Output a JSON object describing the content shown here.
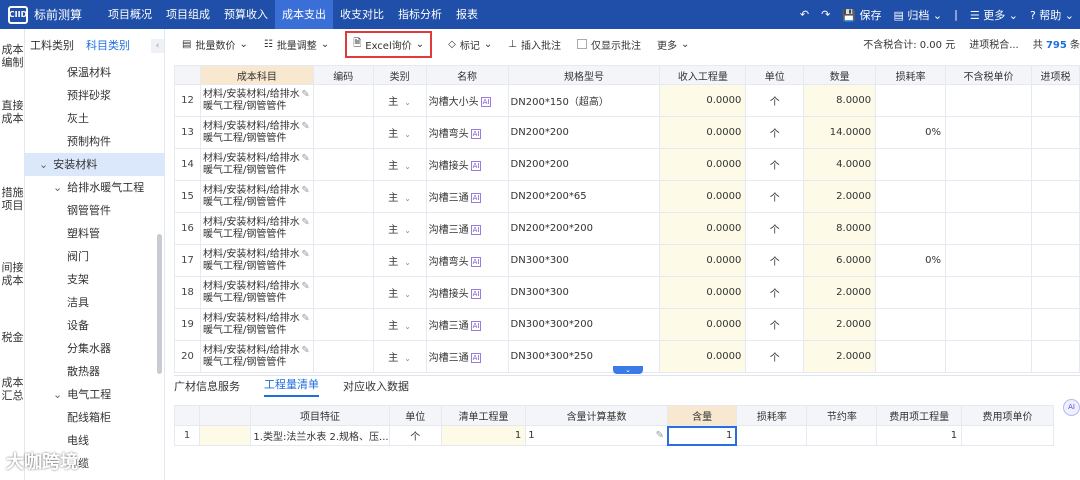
{
  "app": {
    "logo_mark": "CIID",
    "title": "标前测算"
  },
  "nav": [
    "项目概况",
    "项目组成",
    "预算收入",
    "成本支出",
    "收支对比",
    "指标分析",
    "报表"
  ],
  "nav_active": 3,
  "topright": {
    "save": "保存",
    "archive": "归档",
    "more": "更多",
    "help": "帮助"
  },
  "sidebar": [
    "成本编制",
    "直接成本",
    "措施项目",
    "间接成本",
    "税金",
    "成本汇总"
  ],
  "tree": {
    "tabs": [
      "工料类别",
      "科目类别"
    ],
    "items": [
      {
        "label": "保温材料",
        "indent": 3
      },
      {
        "label": "预拌砂浆",
        "indent": 3
      },
      {
        "label": "灰土",
        "indent": 3
      },
      {
        "label": "预制构件",
        "indent": 3
      },
      {
        "label": "安装材料",
        "indent": 1,
        "selected": true,
        "toggle": "⌄"
      },
      {
        "label": "给排水暖气工程",
        "indent": 2,
        "toggle": "⌄"
      },
      {
        "label": "钢管管件",
        "indent": 3
      },
      {
        "label": "塑料管",
        "indent": 3
      },
      {
        "label": "阀门",
        "indent": 3
      },
      {
        "label": "支架",
        "indent": 3
      },
      {
        "label": "洁具",
        "indent": 3
      },
      {
        "label": "设备",
        "indent": 3
      },
      {
        "label": "分集水器",
        "indent": 3
      },
      {
        "label": "散热器",
        "indent": 3
      },
      {
        "label": "电气工程",
        "indent": 2,
        "toggle": "⌄"
      },
      {
        "label": "配线箱柜",
        "indent": 3
      },
      {
        "label": "电线",
        "indent": 3
      },
      {
        "label": "电缆",
        "indent": 3
      }
    ]
  },
  "toolbar": {
    "batch_price": "批量数价",
    "batch_adjust": "批量调整",
    "excel_price": "Excel询价",
    "mark": "标记",
    "insert_note": "插入批注",
    "only_note": "仅显示批注",
    "more": "更多",
    "tax_total": "不含税合计: 0.00 元",
    "tax_in": "进项税合...",
    "total_prefix": "共",
    "total_count": "795",
    "total_suffix": "条"
  },
  "grid": {
    "headers": [
      "成本科目",
      "编码",
      "类别",
      "名称",
      "规格型号",
      "收入工程量",
      "单位",
      "数量",
      "损耗率",
      "不含税单价",
      "进项税"
    ],
    "rows": [
      {
        "n": "12",
        "path": "材料/安装材料/给排水暖气工程/钢管管件",
        "cat": "主",
        "name": "沟槽大小头",
        "spec": "DN200*150（超高）",
        "qty_in": "0.0000",
        "unit": "个",
        "qty": "8.0000",
        "loss": ""
      },
      {
        "n": "13",
        "path": "材料/安装材料/给排水暖气工程/钢管管件",
        "cat": "主",
        "name": "沟槽弯头",
        "spec": "DN200*200",
        "qty_in": "0.0000",
        "unit": "个",
        "qty": "14.0000",
        "loss": "0%"
      },
      {
        "n": "14",
        "path": "材料/安装材料/给排水暖气工程/钢管管件",
        "cat": "主",
        "name": "沟槽接头",
        "spec": "DN200*200",
        "qty_in": "0.0000",
        "unit": "个",
        "qty": "4.0000",
        "loss": ""
      },
      {
        "n": "15",
        "path": "材料/安装材料/给排水暖气工程/钢管管件",
        "cat": "主",
        "name": "沟槽三通",
        "spec": "DN200*200*65",
        "qty_in": "0.0000",
        "unit": "个",
        "qty": "2.0000",
        "loss": ""
      },
      {
        "n": "16",
        "path": "材料/安装材料/给排水暖气工程/钢管管件",
        "cat": "主",
        "name": "沟槽三通",
        "spec": "DN200*200*200",
        "qty_in": "0.0000",
        "unit": "个",
        "qty": "8.0000",
        "loss": ""
      },
      {
        "n": "17",
        "path": "材料/安装材料/给排水暖气工程/钢管管件",
        "cat": "主",
        "name": "沟槽弯头",
        "spec": "DN300*300",
        "qty_in": "0.0000",
        "unit": "个",
        "qty": "6.0000",
        "loss": "0%"
      },
      {
        "n": "18",
        "path": "材料/安装材料/给排水暖气工程/钢管管件",
        "cat": "主",
        "name": "沟槽接头",
        "spec": "DN300*300",
        "qty_in": "0.0000",
        "unit": "个",
        "qty": "2.0000",
        "loss": ""
      },
      {
        "n": "19",
        "path": "材料/安装材料/给排水暖气工程/钢管管件",
        "cat": "主",
        "name": "沟槽三通",
        "spec": "DN300*300*200",
        "qty_in": "0.0000",
        "unit": "个",
        "qty": "2.0000",
        "loss": ""
      },
      {
        "n": "20",
        "path": "材料/安装材料/给排水暖气工程/钢管管件",
        "cat": "主",
        "name": "沟槽三通",
        "spec": "DN300*300*250",
        "qty_in": "0.0000",
        "unit": "个",
        "qty": "2.0000",
        "loss": ""
      }
    ]
  },
  "bottom_tabs": [
    "广材信息服务",
    "工程量清单",
    "对应收入数据"
  ],
  "bottom_active": 1,
  "bottom_grid": {
    "headers": [
      "",
      "项目特征",
      "单位",
      "清单工程量",
      "含量计算基数",
      "含量",
      "损耗率",
      "节约率",
      "费用项工程量",
      "费用项单价"
    ],
    "row": {
      "n": "1",
      "feature": "1.类型:法兰水表 2.规格、压...",
      "unit": "个",
      "qty": "1",
      "base": "1",
      "content": "1",
      "fee_qty": "1"
    }
  },
  "watermark": "大咖跨境",
  "ai_badge": "AI"
}
